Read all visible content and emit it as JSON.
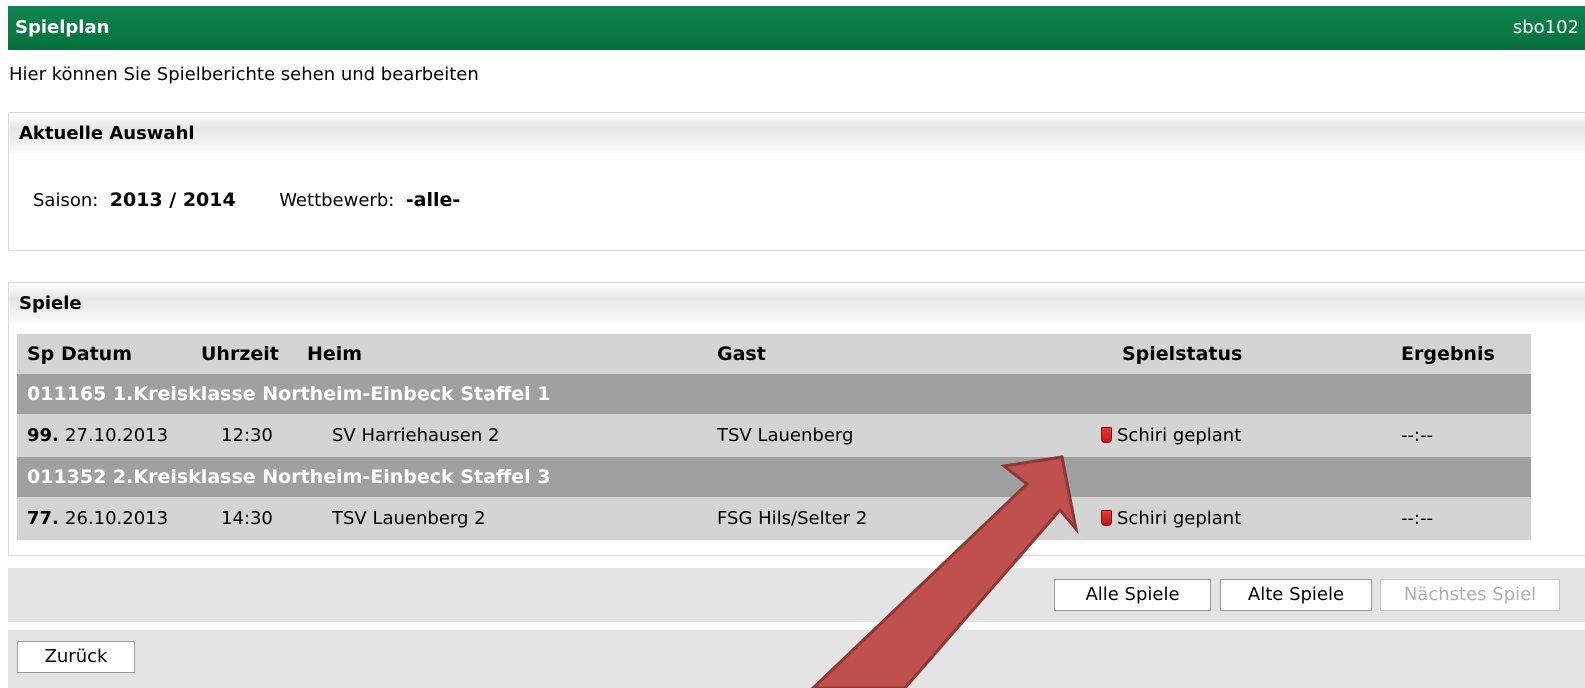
{
  "header": {
    "title": "Spielplan",
    "code": "sbo102"
  },
  "subtitle": "Hier können Sie Spielberichte sehen und bearbeiten",
  "selection": {
    "heading": "Aktuelle Auswahl",
    "season_label": "Saison:",
    "season_value": "2013 / 2014",
    "competition_label": "Wettbewerb:",
    "competition_value": "-alle-"
  },
  "games": {
    "heading": "Spiele",
    "columns": [
      "Sp",
      "Datum",
      "Uhrzeit",
      "Heim",
      "Gast",
      "Spielstatus",
      "Ergebnis"
    ],
    "groups": [
      {
        "title": "011165 1.Kreisklasse Northeim-Einbeck Staffel 1",
        "match": {
          "nr": "99.",
          "date": "27.10.2013",
          "time": "12:30",
          "home": "SV Harriehausen 2",
          "guest": "TSV Lauenberg",
          "status": "Schiri geplant",
          "result": "--:--"
        }
      },
      {
        "title": "011352 2.Kreisklasse Northeim-Einbeck Staffel 3",
        "match": {
          "nr": "77.",
          "date": "26.10.2013",
          "time": "14:30",
          "home": "TSV Lauenberg 2",
          "guest": "FSG Hils/Selter 2",
          "status": "Schiri geplant",
          "result": "--:--"
        }
      }
    ]
  },
  "buttons": {
    "all_games": "Alle Spiele",
    "old_games": "Alte Spiele",
    "next_game": "Nächstes Spiel",
    "back": "Zurück"
  },
  "colors": {
    "header_green": "#0b7a47",
    "arrow_red": "#c0504d",
    "status_marker": "#d62828"
  },
  "annotation": {
    "type": "arrow",
    "points_to": "status-icon"
  }
}
